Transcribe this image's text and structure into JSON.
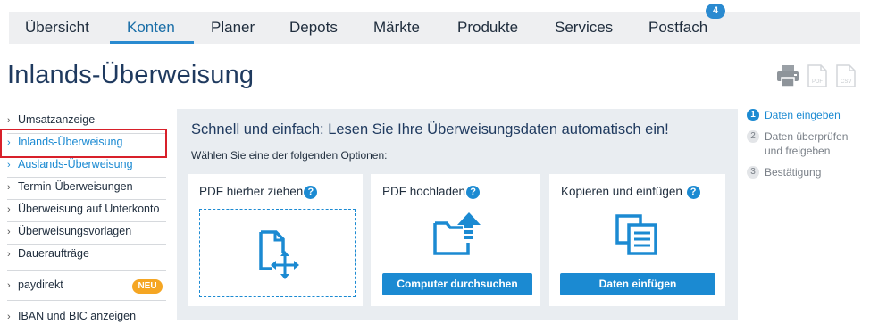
{
  "nav": {
    "tabs": [
      {
        "label": "Übersicht"
      },
      {
        "label": "Konten"
      },
      {
        "label": "Planer"
      },
      {
        "label": "Depots"
      },
      {
        "label": "Märkte"
      },
      {
        "label": "Produkte"
      },
      {
        "label": "Services"
      },
      {
        "label": "Postfach"
      }
    ],
    "active_tab": "Konten",
    "postfach_count": "4"
  },
  "page": {
    "title": "Inlands-Überweisung"
  },
  "toolbar": {
    "icons": [
      "print-icon",
      "pdf-icon",
      "csv-icon"
    ],
    "pdf_label": "PDF",
    "csv_label": "CSV"
  },
  "sidebar": {
    "items": [
      {
        "label": "Umsatzanzeige"
      },
      {
        "label": "Inlands-Überweisung"
      },
      {
        "label": "Auslands-Überweisung"
      },
      {
        "label": "Termin-Überweisungen"
      },
      {
        "label": "Überweisung auf Unterkonto"
      },
      {
        "label": "Überweisungsvorlagen"
      },
      {
        "label": "Daueraufträge"
      },
      {
        "label": "paydirekt"
      },
      {
        "label": "IBAN und BIC anzeigen"
      }
    ],
    "highlighted_item": "Inlands-Überweisung",
    "paydirekt_badge": "NEU"
  },
  "main": {
    "heading": "Schnell und einfach: Lesen Sie Ihre Überweisungsdaten automatisch ein!",
    "subheading": "Wählen Sie eine der folgenden Optionen:",
    "cards": [
      {
        "title": "PDF hierher ziehen",
        "help": "?",
        "icon": "drag-drop-document-icon"
      },
      {
        "title": "PDF hochladen",
        "help": "?",
        "icon": "upload-folder-icon",
        "button": "Computer durchsuchen"
      },
      {
        "title": "Kopieren und einfügen",
        "help": "?",
        "icon": "copy-paste-icon",
        "button": "Daten einfügen"
      }
    ]
  },
  "steps": [
    {
      "number": "1",
      "label": "Daten eingeben",
      "state": "active"
    },
    {
      "number": "2",
      "label": "Daten überprüfen und freigeben",
      "state": "inactive"
    },
    {
      "number": "3",
      "label": "Bestätigung",
      "state": "inactive"
    }
  ],
  "colors": {
    "accent": "#1b8ad2",
    "highlight_border": "#d8202a",
    "badge_orange": "#f5a623",
    "panel_bg": "#e9edf1",
    "nav_bg": "#eeeff1"
  }
}
